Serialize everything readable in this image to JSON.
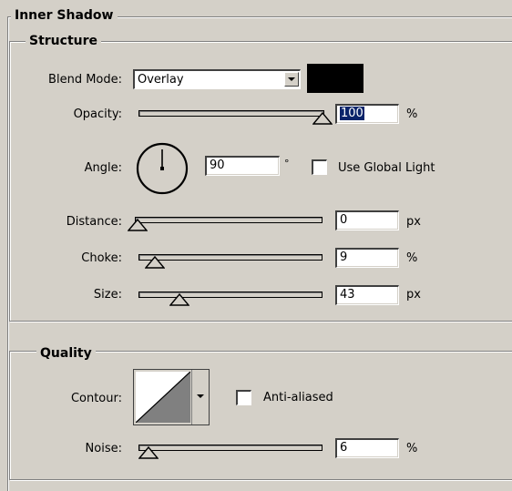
{
  "panel": {
    "title": "Inner Shadow"
  },
  "structure": {
    "title": "Structure",
    "blend_mode_label": "Blend Mode:",
    "blend_mode_value": "Overlay",
    "color_swatch": "#000000",
    "opacity_label": "Opacity:",
    "opacity_value": "100",
    "opacity_unit": "%",
    "opacity_level": 100,
    "angle_label": "Angle:",
    "angle_value": "90",
    "angle_unit": "°",
    "use_global_light_label": "Use Global Light",
    "use_global_light_checked": false,
    "distance_label": "Distance:",
    "distance_value": "0",
    "distance_unit": "px",
    "distance_level": 0,
    "choke_label": "Choke:",
    "choke_value": "9",
    "choke_unit": "%",
    "choke_level": 9,
    "size_label": "Size:",
    "size_value": "43",
    "size_unit": "px",
    "size_level": 17
  },
  "quality": {
    "title": "Quality",
    "contour_label": "Contour:",
    "anti_aliased_label": "Anti-aliased",
    "anti_aliased_checked": false,
    "noise_label": "Noise:",
    "noise_value": "6",
    "noise_unit": "%",
    "noise_level": 6
  }
}
